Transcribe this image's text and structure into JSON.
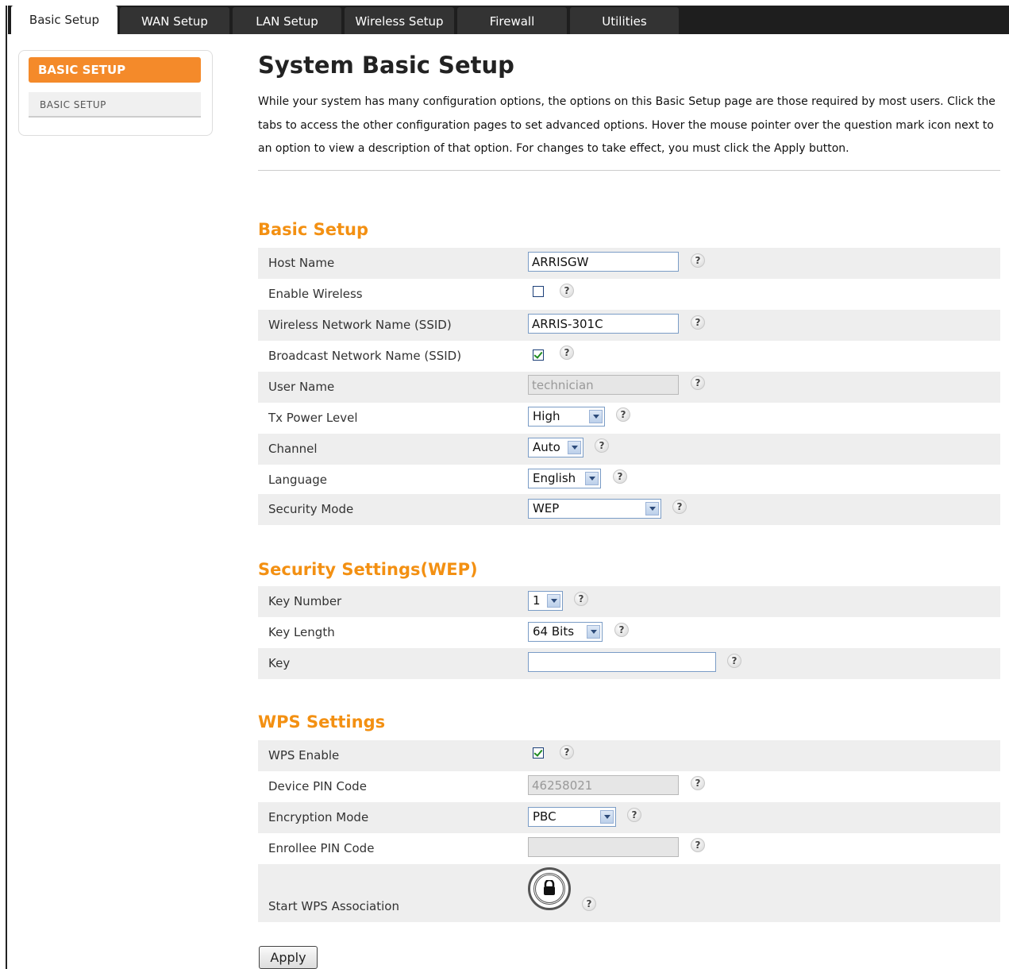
{
  "tabs": [
    {
      "label": "Basic Setup",
      "active": true
    },
    {
      "label": "WAN Setup",
      "active": false
    },
    {
      "label": "LAN Setup",
      "active": false
    },
    {
      "label": "Wireless Setup",
      "active": false
    },
    {
      "label": "Firewall",
      "active": false
    },
    {
      "label": "Utilities",
      "active": false
    }
  ],
  "sidebar": {
    "header": "BASIC SETUP",
    "items": [
      {
        "label": "BASIC SETUP"
      }
    ]
  },
  "page": {
    "title": "System Basic Setup",
    "intro": "While your system has many configuration options, the options on this Basic Setup page are those required by most users. Click the tabs to access the other configuration pages to set advanced options. Hover the mouse pointer over the question mark icon next to an option to view a description of that option. For changes to take effect, you must click the Apply button."
  },
  "basic": {
    "title": "Basic Setup",
    "host_name": {
      "label": "Host Name",
      "value": "ARRISGW"
    },
    "enable_wireless": {
      "label": "Enable Wireless",
      "checked": false
    },
    "ssid": {
      "label": "Wireless Network Name (SSID)",
      "value": "ARRIS-301C"
    },
    "broadcast_ssid": {
      "label": "Broadcast Network Name (SSID)",
      "checked": true
    },
    "user_name": {
      "label": "User Name",
      "value": "technician"
    },
    "tx_power": {
      "label": "Tx Power Level",
      "value": "High"
    },
    "channel": {
      "label": "Channel",
      "value": "Auto"
    },
    "language": {
      "label": "Language",
      "value": "English"
    },
    "security_mode": {
      "label": "Security Mode",
      "value": "WEP"
    }
  },
  "security": {
    "title": "Security Settings(WEP)",
    "key_number": {
      "label": "Key Number",
      "value": "1"
    },
    "key_length": {
      "label": "Key Length",
      "value": "64 Bits"
    },
    "key": {
      "label": "Key",
      "value": ""
    }
  },
  "wps": {
    "title": "WPS Settings",
    "enable": {
      "label": "WPS Enable",
      "checked": true
    },
    "device_pin": {
      "label": "Device PIN Code",
      "value": "46258021"
    },
    "encryption_mode": {
      "label": "Encryption Mode",
      "value": "PBC"
    },
    "enrollee_pin": {
      "label": "Enrollee PIN Code",
      "value": ""
    },
    "start": {
      "label": "Start WPS Association"
    }
  },
  "help_glyph": "?",
  "apply_label": "Apply"
}
